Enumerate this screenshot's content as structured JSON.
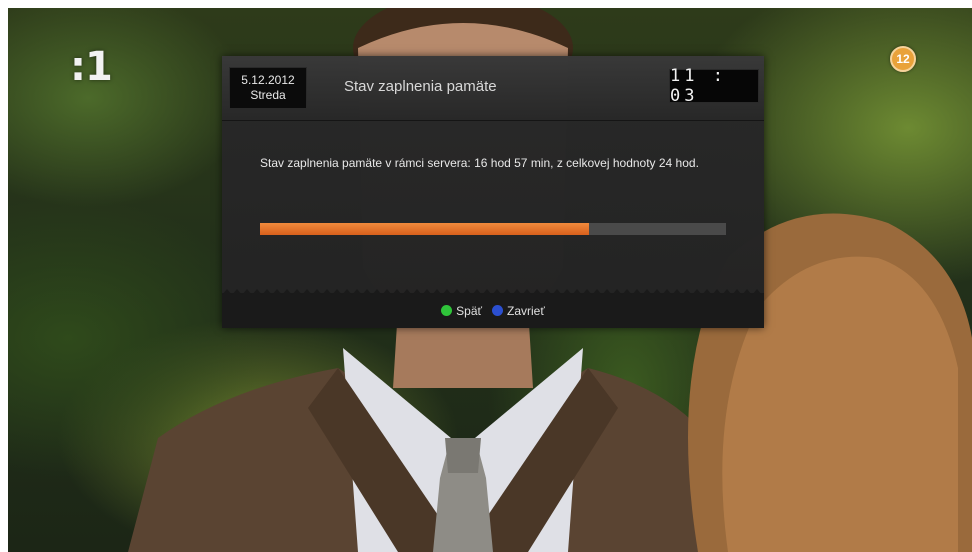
{
  "channel": {
    "logo": ":1",
    "age_rating": "12"
  },
  "osd": {
    "date": "5.12.2012",
    "weekday": "Streda",
    "title": "Stav zaplnenia pamäte",
    "clock": "11 : 03",
    "message": "Stav zaplnenia pamäte v rámci servera: 16 hod 57 min, z celkovej hodnoty 24 hod.",
    "progress_percent": 70.6,
    "buttons": [
      {
        "label": "Späť",
        "color": "#2fc43a",
        "icon": "green-button-icon"
      },
      {
        "label": "Zavrieť",
        "color": "#2b4fd0",
        "icon": "blue-button-icon"
      }
    ]
  },
  "colors": {
    "accent": "#e8731f",
    "panel": "#202020"
  }
}
